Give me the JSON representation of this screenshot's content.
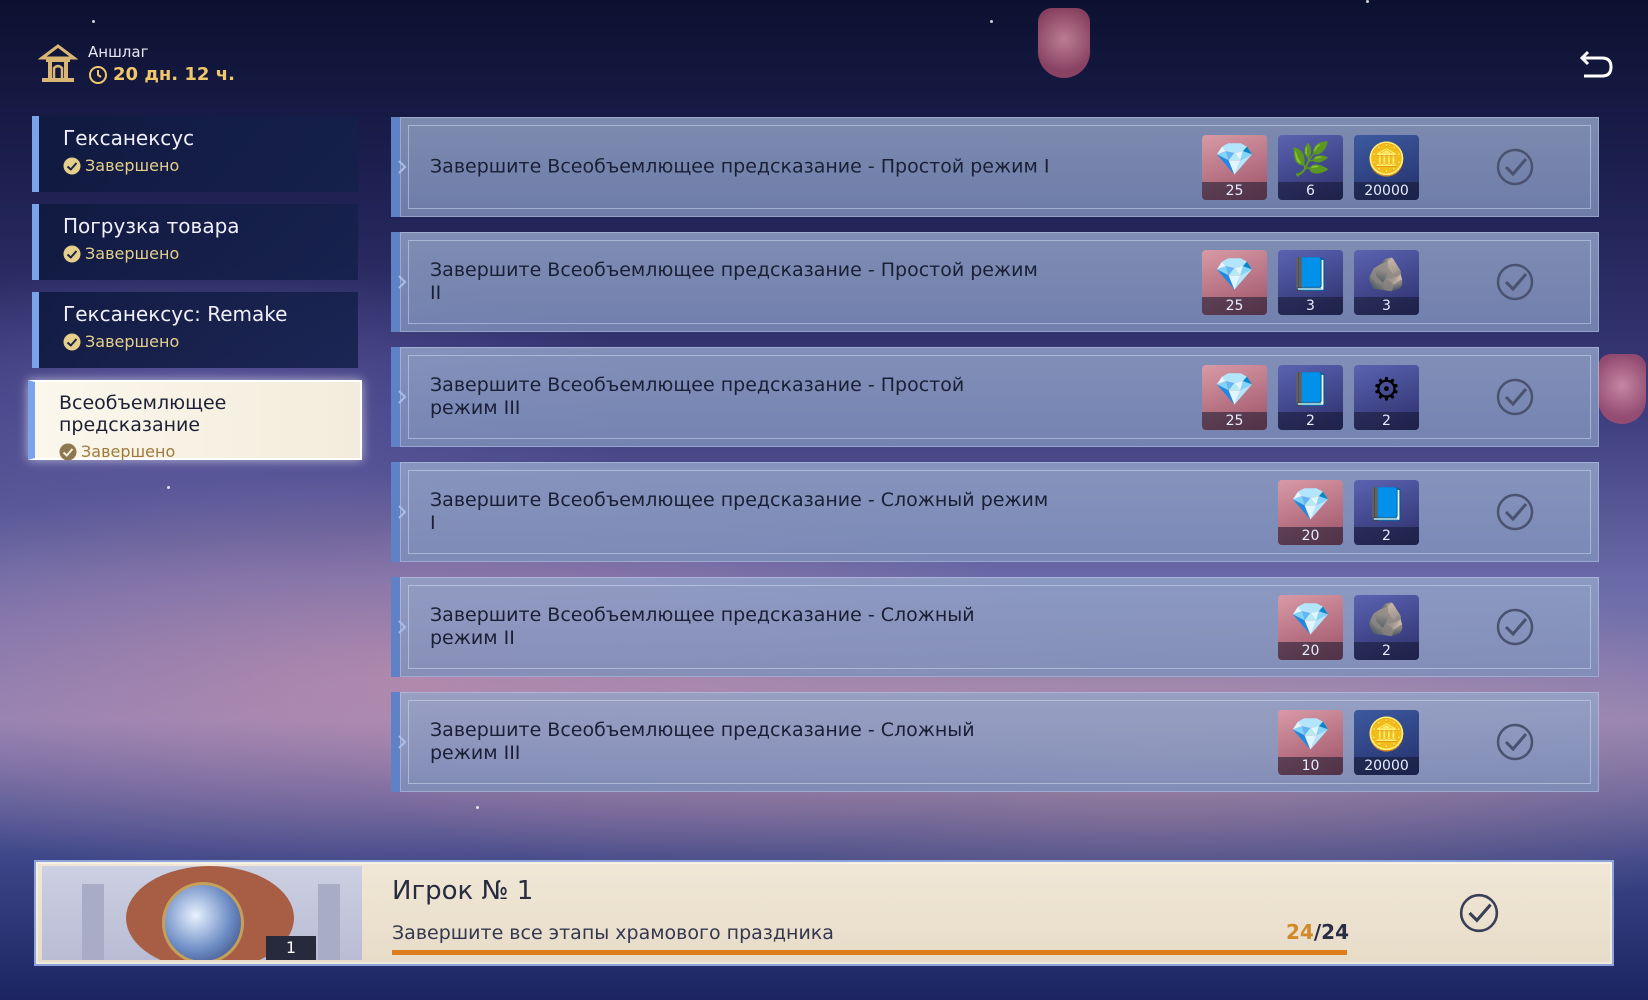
{
  "event": {
    "name": "Аншлаг",
    "timer": "20 дн. 12 ч."
  },
  "sidebar": {
    "items": [
      {
        "title": "Гексанексус",
        "status": "Завершено",
        "active": false
      },
      {
        "title": "Погрузка товара",
        "status": "Завершено",
        "active": false
      },
      {
        "title": "Гексанексус: Remake",
        "status": "Завершено",
        "active": false
      },
      {
        "title": "Всеобъемлющее предсказание",
        "status": "Завершено",
        "active": true
      }
    ]
  },
  "tasks": [
    {
      "description": "Завершите Всеобъемлющее предсказание - Простой режим I",
      "rewards": [
        {
          "icon": "crystal-icon",
          "count": "25"
        },
        {
          "icon": "leaf-icon",
          "count": "6"
        },
        {
          "icon": "mora-icon",
          "count": "20000"
        }
      ]
    },
    {
      "description": "Завершите Всеобъемлющее предсказание - Простой режим II",
      "rewards": [
        {
          "icon": "crystal-icon",
          "count": "25"
        },
        {
          "icon": "hero-wit-icon",
          "count": "3"
        },
        {
          "icon": "ore-icon",
          "count": "3"
        }
      ]
    },
    {
      "description": "Завершите Всеобъемлющее предсказание - Простой режим III",
      "rewards": [
        {
          "icon": "crystal-icon",
          "count": "25"
        },
        {
          "icon": "hero-wit-icon",
          "count": "2"
        },
        {
          "icon": "magic-ore-icon",
          "count": "2"
        }
      ]
    },
    {
      "description": "Завершите Всеобъемлющее предсказание - Сложный режим I",
      "rewards": [
        {
          "icon": "crystal-icon",
          "count": "20"
        },
        {
          "icon": "hero-wit-icon",
          "count": "2"
        }
      ]
    },
    {
      "description": "Завершите Всеобъемлющее предсказание - Сложный режим II",
      "rewards": [
        {
          "icon": "crystal-icon",
          "count": "20"
        },
        {
          "icon": "ore-icon",
          "count": "2"
        }
      ]
    },
    {
      "description": "Завершите Всеобъемлющее предсказание - Сложный режим III",
      "rewards": [
        {
          "icon": "crystal-icon",
          "count": "10"
        },
        {
          "icon": "mora-icon",
          "count": "20000"
        }
      ]
    }
  ],
  "milestone": {
    "title": "Игрок № 1",
    "description": "Завершите все этапы храмового праздника",
    "reward_count": "1",
    "progress_current": "24",
    "progress_total": "24",
    "progress_fraction": 1.0
  },
  "colors": {
    "accent_blue": "#7aa4ea",
    "timer_gold": "#f0c86a",
    "progress_orange": "#de7d1e"
  }
}
